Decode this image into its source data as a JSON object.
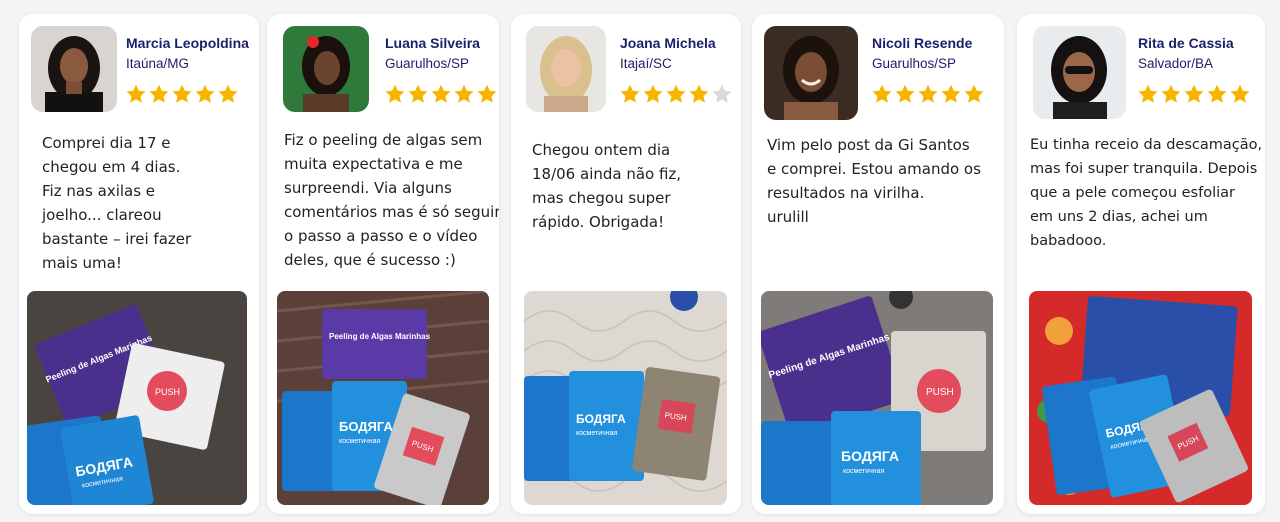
{
  "star_color": "#f7b500",
  "star_empty_color": "#d9d9d9",
  "name_color": "#1c1f6b",
  "reviews": [
    {
      "name": "Marcia Leopoldina",
      "location": "Itaúna/MG",
      "rating": 5,
      "text_lines": [
        "Comprei dia 17 e",
        "chegou em 4 dias.",
        "Fiz nas axilas e",
        "joelho... clareou",
        "bastante – irei fazer",
        "mais uma!"
      ],
      "photo_text": {
        "pack_title": "Peeling de Algas Marinhas",
        "pack_brand": "БОДЯГА",
        "pack_sub": "косметичная",
        "sachet_logo": "PUSH"
      }
    },
    {
      "name": "Luana Silveira",
      "location": "Guarulhos/SP",
      "rating": 5,
      "text_lines": [
        "Fiz o peeling de algas sem",
        "muita expectativa e me",
        "surpreendi. Via alguns",
        "comentários mas é só seguir",
        "o passo a passo e o vídeo",
        "deles, que é sucesso :)"
      ],
      "photo_text": {
        "pack_title": "Peeling de Algas Marinhas",
        "pack_brand": "БОДЯГА",
        "pack_sub": "косметичная",
        "sachet_logo": "PUSH"
      }
    },
    {
      "name": "Joana Michela",
      "location": "Itajaí/SC",
      "rating": 4,
      "text_lines": [
        "Chegou ontem dia",
        "18/06 ainda não fiz,",
        "mas chegou super",
        "rápido. Obrigada!"
      ],
      "photo_text": {
        "pack_title": "",
        "pack_brand": "БОДЯГА",
        "pack_sub": "косметичная",
        "sachet_logo": "PUSH"
      }
    },
    {
      "name": "Nicoli Resende",
      "location": "Guarulhos/SP",
      "rating": 5,
      "text_lines": [
        "Vim pelo post da Gi Santos",
        "e comprei. Estou amando os",
        "resultados na virilha.",
        "urulill"
      ],
      "photo_text": {
        "pack_title": "Peeling de Algas Marinhas",
        "pack_brand": "БОДЯГА",
        "pack_sub": "косметичная",
        "sachet_logo": "PUSH"
      }
    },
    {
      "name": "Rita de Cassia",
      "location": "Salvador/BA",
      "rating": 5,
      "text_lines": [
        "Eu tinha receio da descamação,",
        "mas foi super tranquila. Depois",
        "que a pele começou esfoliar",
        "em uns 2 dias, achei um",
        "babadooo."
      ],
      "photo_text": {
        "pack_title": "",
        "pack_brand": "БОДЯГА",
        "pack_sub": "косметичная",
        "sachet_logo": "PUSH"
      }
    }
  ]
}
